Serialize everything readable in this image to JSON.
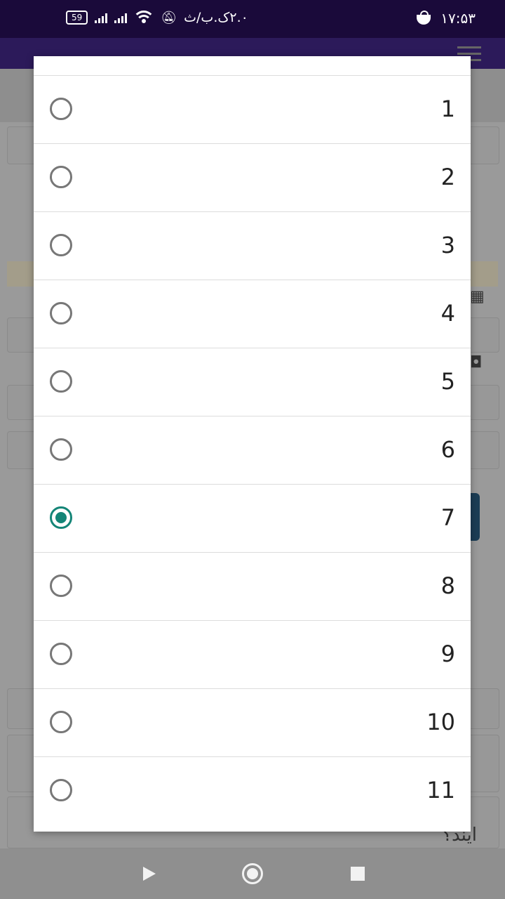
{
  "status_bar": {
    "battery": "59",
    "network_text": "۲.۰ک.ب/ث",
    "time": "۱۷:۵۳"
  },
  "background": {
    "bottom_text": "ایند؟"
  },
  "dialog": {
    "options": [
      {
        "label": "1",
        "selected": false
      },
      {
        "label": "2",
        "selected": false
      },
      {
        "label": "3",
        "selected": false
      },
      {
        "label": "4",
        "selected": false
      },
      {
        "label": "5",
        "selected": false
      },
      {
        "label": "6",
        "selected": false
      },
      {
        "label": "7",
        "selected": true
      },
      {
        "label": "8",
        "selected": false
      },
      {
        "label": "9",
        "selected": false
      },
      {
        "label": "10",
        "selected": false
      },
      {
        "label": "11",
        "selected": false
      }
    ]
  },
  "colors": {
    "accent": "#148577",
    "status_bar": "#1a0a3a"
  }
}
